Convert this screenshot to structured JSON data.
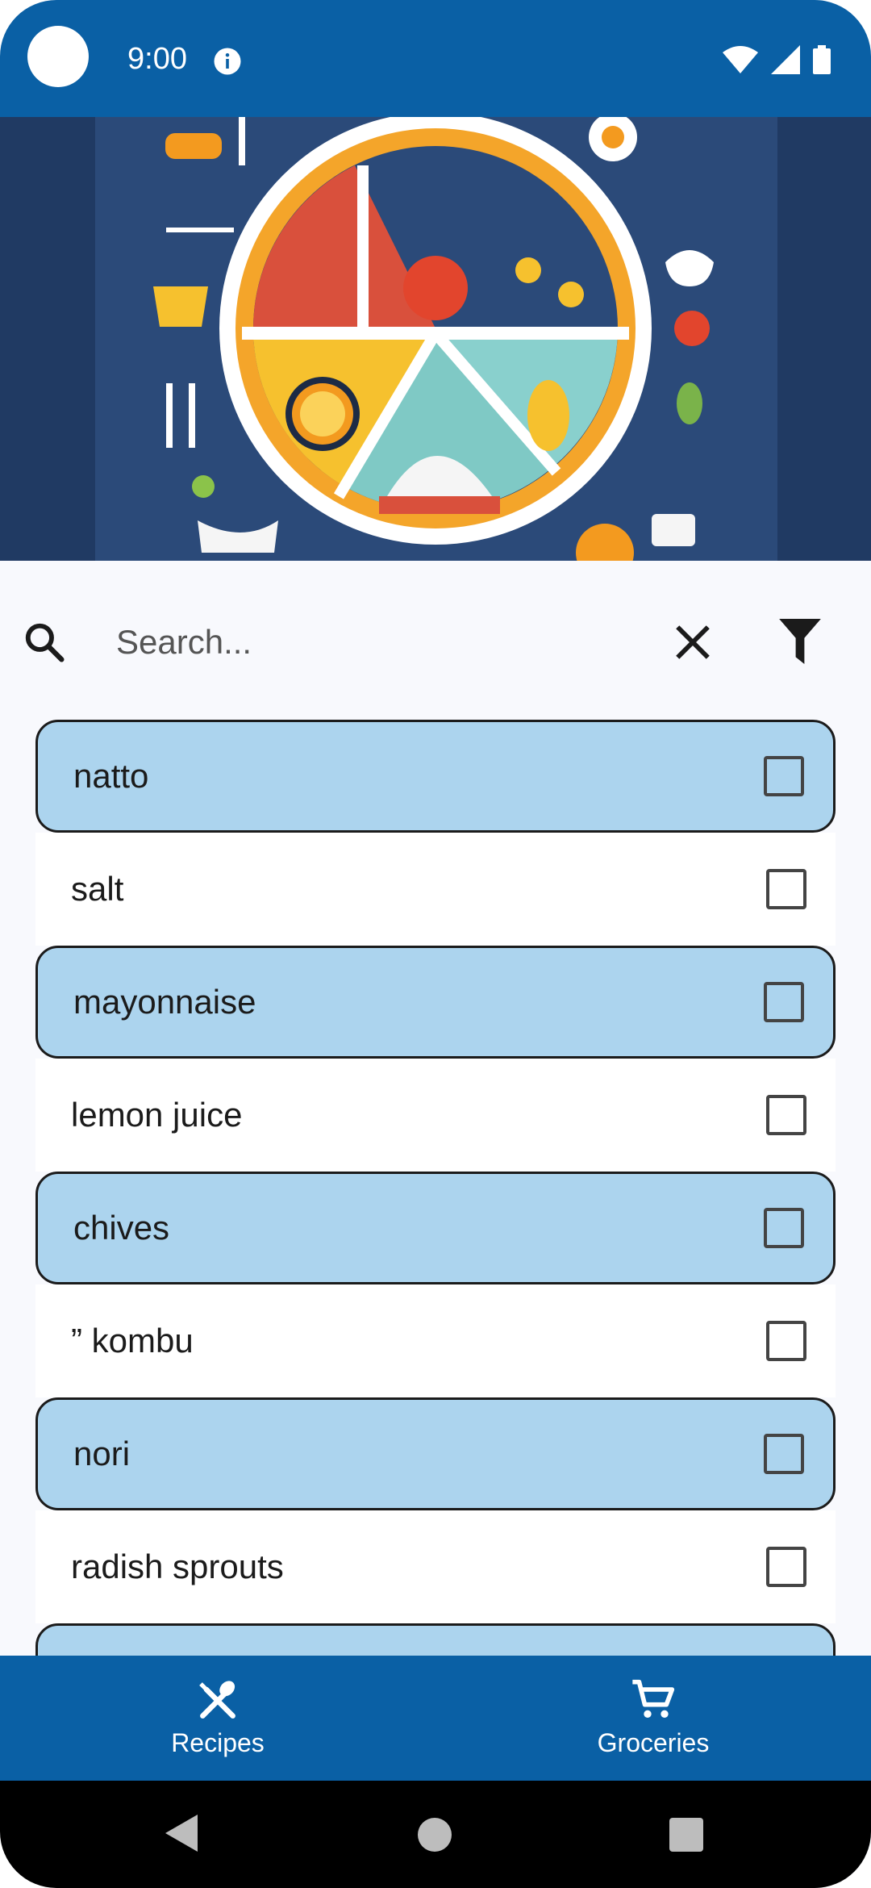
{
  "status_bar": {
    "time": "9:00"
  },
  "search": {
    "placeholder": "Search..."
  },
  "ingredients": [
    {
      "label": "natto",
      "highlighted": true,
      "checked": false
    },
    {
      "label": "salt",
      "highlighted": false,
      "checked": false
    },
    {
      "label": "mayonnaise",
      "highlighted": true,
      "checked": false
    },
    {
      "label": "lemon juice",
      "highlighted": false,
      "checked": false
    },
    {
      "label": "chives",
      "highlighted": true,
      "checked": false
    },
    {
      "label": "” kombu",
      "highlighted": false,
      "checked": false
    },
    {
      "label": "nori",
      "highlighted": true,
      "checked": false
    },
    {
      "label": "radish sprouts",
      "highlighted": false,
      "checked": false
    },
    {
      "label": "",
      "highlighted": true,
      "checked": false
    }
  ],
  "bottom_nav": {
    "recipes_label": "Recipes",
    "groceries_label": "Groceries"
  },
  "colors": {
    "primary": "#0a60a5",
    "highlight_row": "#acd4ee"
  }
}
